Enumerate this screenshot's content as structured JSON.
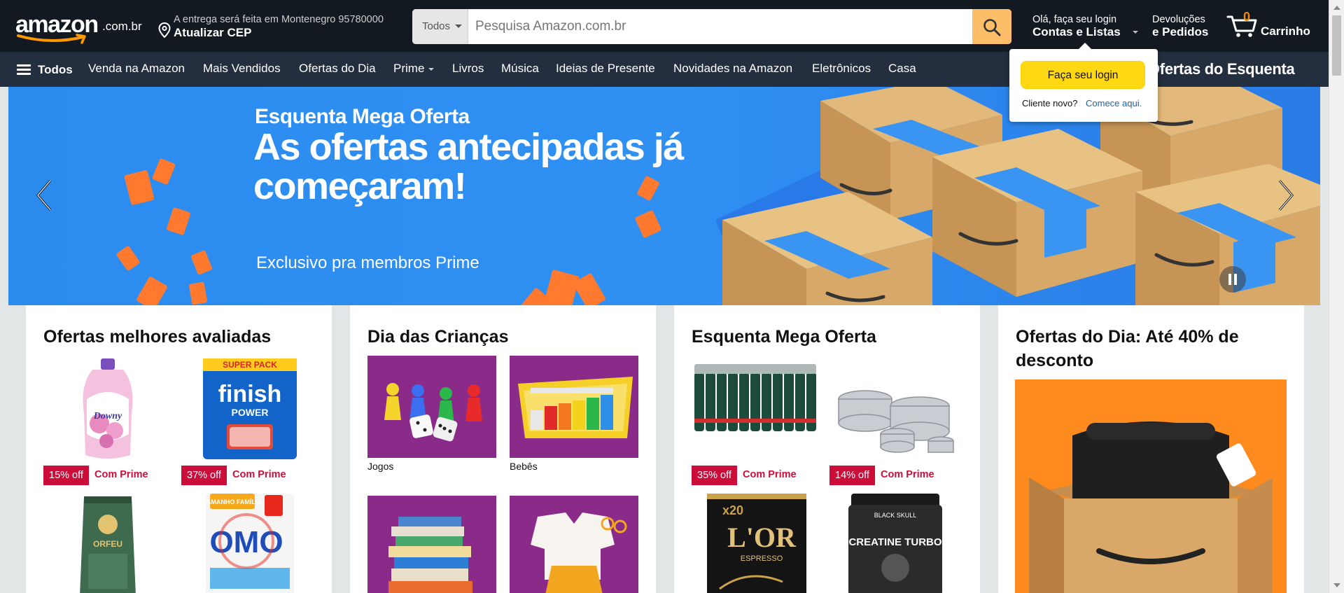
{
  "header": {
    "logo_text": "amazon",
    "logo_tld": ".com.br",
    "deliver_line1": "A entrega será feita em Montenegro 95780000",
    "deliver_line2": "Atualizar CEP",
    "search_category": "Todos",
    "search_placeholder": "Pesquisa Amazon.com.br",
    "account_line1": "Olá, faça seu login",
    "account_line2": "Contas e Listas",
    "returns_line1": "Devoluções",
    "returns_line2": "e Pedidos",
    "cart_count": "0",
    "cart_label": "Carrinho"
  },
  "nav": {
    "all_label": "Todos",
    "items": [
      "Venda na Amazon",
      "Mais Vendidos",
      "Ofertas do Dia",
      "Prime",
      "Livros",
      "Música",
      "Ideias de Presente",
      "Novidades na Amazon",
      "Eletrônicos",
      "Casa"
    ],
    "promo": "Ofertas do Esquenta"
  },
  "hero": {
    "kicker": "Esquenta Mega Oferta",
    "headline": "As ofertas antecipadas já começaram!",
    "subtitle": "Exclusivo pra membros Prime"
  },
  "flyout": {
    "signin_button": "Faça seu login",
    "new_customer": "Cliente novo?",
    "start_link": "Comece aqui."
  },
  "cards": [
    {
      "title": "Ofertas melhores avaliadas",
      "deals": [
        {
          "pct": "15% off",
          "label": "Com Prime"
        },
        {
          "pct": "37% off",
          "label": "Com Prime"
        }
      ],
      "product_text": {
        "finish_top": "SUPER PACK",
        "finish_brand": "finish",
        "finish_sub": "POWER",
        "omo_top": "TAMANHO FAMÍLIA",
        "omo_brand": "OMO",
        "coffee_brand": "ORFEU",
        "downy_brand": "Downy"
      }
    },
    {
      "title": "Dia das Crianças",
      "tiles": [
        {
          "caption": "Jogos"
        },
        {
          "caption": "Bebês"
        },
        {
          "caption": ""
        },
        {
          "caption": ""
        }
      ]
    },
    {
      "title": "Esquenta Mega Oferta",
      "deals": [
        {
          "pct": "35% off",
          "label": "Com Prime"
        },
        {
          "pct": "14% off",
          "label": "Com Prime"
        }
      ],
      "product_text": {
        "lor_count": "x20",
        "lor_brand": "L'OR",
        "lor_sub": "ESPRESSO",
        "creatine": "CREATINE TURBO",
        "bs_brand": "BLACK SKULL"
      }
    },
    {
      "title": "Ofertas do Dia: Até 40% de desconto"
    }
  ],
  "colors": {
    "header_bg": "#131921",
    "nav_bg": "#232f3e",
    "search_button": "#febd69",
    "signin_button": "#ffd814",
    "deal_red": "#cc0c39",
    "hero_blue": "#2f8ef0",
    "link_blue": "#2162a1"
  }
}
